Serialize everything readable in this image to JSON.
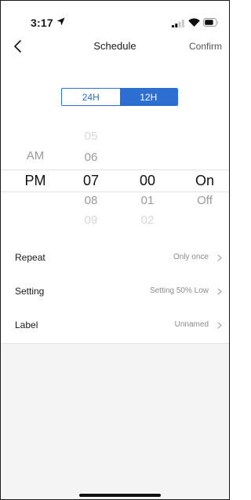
{
  "status_bar": {
    "time": "3:17",
    "icons": [
      "location-arrow-icon",
      "signal-icon",
      "wifi-icon",
      "battery-icon"
    ]
  },
  "nav": {
    "back_icon": "chevron-left-icon",
    "title": "Schedule",
    "confirm_label": "Confirm"
  },
  "format_toggle": {
    "options": [
      "24H",
      "12H"
    ],
    "selected": "12H",
    "accent_color": "#2c6fd1"
  },
  "picker": {
    "ampm": {
      "above": [
        "AM"
      ],
      "selected": "PM",
      "below": []
    },
    "hour": {
      "above": [
        "05",
        "06"
      ],
      "selected": "07",
      "below": [
        "08",
        "09"
      ]
    },
    "minute": {
      "above": [],
      "selected": "00",
      "below": [
        "01",
        "02"
      ]
    },
    "state": {
      "above": [],
      "selected": "On",
      "below": [
        "Off"
      ]
    }
  },
  "settings": [
    {
      "label": "Repeat",
      "value": "Only once"
    },
    {
      "label": "Setting",
      "value": "Setting 50% Low"
    },
    {
      "label": "Label",
      "value": "Unnamed"
    }
  ]
}
